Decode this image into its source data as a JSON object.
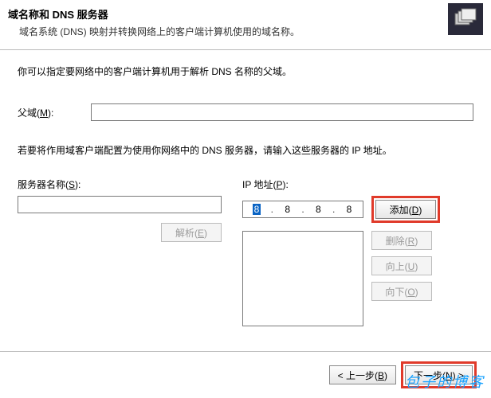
{
  "header": {
    "title": "域名称和 DNS 服务器",
    "subtitle": "域名系统 (DNS) 映射并转换网络上的客户端计算机使用的域名称。",
    "icon": "folders-icon"
  },
  "intro": "你可以指定要网络中的客户端计算机用于解析 DNS 名称的父域。",
  "parent_domain": {
    "label": "父域(M):",
    "value": ""
  },
  "instruction": "若要将作用域客户端配置为使用你网络中的 DNS 服务器，请输入这些服务器的 IP 地址。",
  "server_name": {
    "label": "服务器名称(S):",
    "value": ""
  },
  "ip": {
    "label": "IP 地址(P):",
    "oct1": "8",
    "oct2": "8",
    "oct3": "8",
    "oct4": "8"
  },
  "buttons": {
    "add": "添加(D)",
    "resolve": "解析(E)",
    "remove": "删除(R)",
    "up": "向上(U)",
    "down": "向下(O)",
    "back": "< 上一步(B)",
    "next": "下一步(N) >"
  },
  "list": {
    "empty": ""
  },
  "watermark": "包子的博客"
}
